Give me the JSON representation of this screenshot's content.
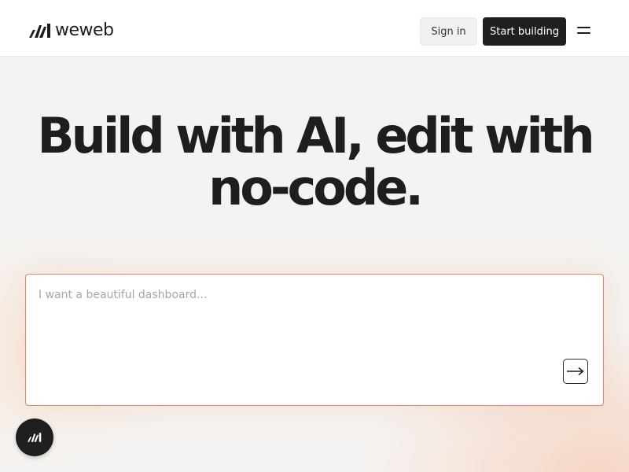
{
  "header": {
    "logo_text": "weweb",
    "logo_icon": "weweb-logo-icon",
    "signin_label": "Sign in",
    "start_label": "Start building",
    "menu_icon": "hamburger-menu-icon"
  },
  "hero": {
    "title": "Build with AI, edit with no-code."
  },
  "prompt": {
    "placeholder": "I want a beautiful dashboard...",
    "value": "",
    "submit_icon": "arrow-right-icon"
  },
  "fab": {
    "icon": "weweb-logo-icon"
  },
  "colors": {
    "primary_button": "#1f1f1f",
    "prompt_border": "#e2836a",
    "background": "#f5f3f1"
  }
}
